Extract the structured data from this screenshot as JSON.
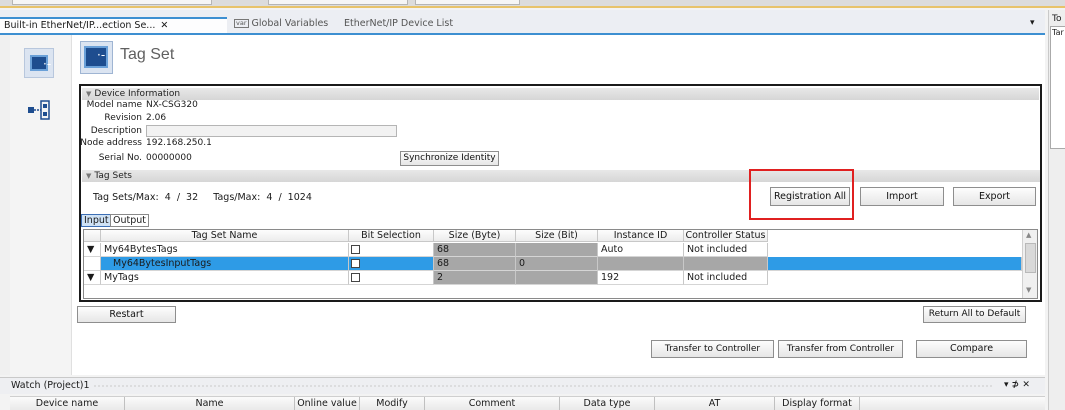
{
  "tabs": [
    {
      "label": "Built-in EtherNet/IP...ection Se...",
      "active": true
    },
    {
      "label": "Global Variables",
      "badge": "var"
    },
    {
      "label": "EtherNet/IP Device List"
    }
  ],
  "tab_close_glyph": "✕",
  "tab_menu_glyph": "▾",
  "page_title": "Tag Set",
  "device_info": {
    "header": "Device Information",
    "model_name_label": "Model name",
    "model_name": "NX-CSG320",
    "revision_label": "Revision",
    "revision": "2.06",
    "description_label": "Description",
    "node_address_label": "Node address",
    "node_address": "192.168.250.1",
    "serial_label": "Serial No.",
    "serial": "00000000",
    "sync_button": "Synchronize Identity"
  },
  "tag_sets": {
    "header": "Tag Sets",
    "summary": "Tag Sets/Max:  4  /  32     Tags/Max:  4  /  1024",
    "registration_all": "Registration All",
    "import": "Import",
    "export": "Export",
    "subtabs": [
      "Input",
      "Output"
    ],
    "columns": [
      "Tag Set Name",
      "Bit Selection",
      "Size (Byte)",
      "Size (Bit)",
      "Instance ID",
      "Controller Status"
    ],
    "rows": [
      {
        "expander": "▼",
        "name": "My64BytesTags",
        "size_byte": "68",
        "size_bit": "",
        "instance_id": "Auto",
        "status": "Not included"
      },
      {
        "expander": "",
        "name": "My64BytesInputTags",
        "size_byte": "68",
        "size_bit": "0",
        "instance_id": "",
        "status": "",
        "selected": true
      },
      {
        "expander": "▼",
        "name": "MyTags",
        "size_byte": "2",
        "size_bit": "",
        "instance_id": "192",
        "status": "Not included"
      }
    ]
  },
  "buttons": {
    "restart": "Restart",
    "return_default": "Return All to Default",
    "transfer_to": "Transfer to Controller",
    "transfer_from": "Transfer from Controller",
    "compare": "Compare"
  },
  "watch": {
    "title": "Watch (Project)1",
    "controls": "▾ ⊅ ✕",
    "columns": [
      "Device name",
      "Name",
      "Online value",
      "Modify",
      "Comment",
      "Data type",
      "AT",
      "Display format"
    ]
  },
  "right_pane": {
    "label": "To",
    "sub": "Tar"
  },
  "colors": {
    "accent": "#3d8fd1",
    "selection": "#2e9be6",
    "highlight_box": "#e02020"
  }
}
